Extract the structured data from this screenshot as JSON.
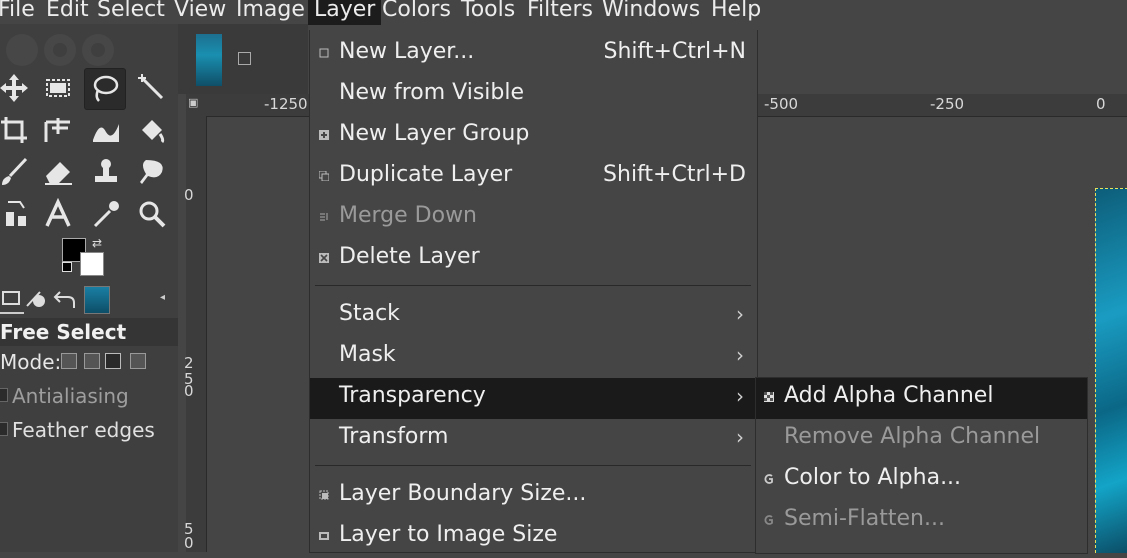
{
  "menubar": {
    "items": [
      {
        "label": "File"
      },
      {
        "label": "Edit"
      },
      {
        "label": "Select"
      },
      {
        "label": "View"
      },
      {
        "label": "Image"
      },
      {
        "label": "Layer"
      },
      {
        "label": "Colors"
      },
      {
        "label": "Tools"
      },
      {
        "label": "Filters"
      },
      {
        "label": "Windows"
      },
      {
        "label": "Help"
      }
    ],
    "active": "Layer"
  },
  "toolbox": {
    "tools": [
      {
        "icon": "move-icon"
      },
      {
        "icon": "rect-select-icon"
      },
      {
        "icon": "free-select-icon",
        "selected": true
      },
      {
        "icon": "fuzzy-select-icon"
      },
      {
        "icon": "crop-icon"
      },
      {
        "icon": "unified-transform-icon"
      },
      {
        "icon": "warp-transform-icon"
      },
      {
        "icon": "bucket-fill-icon"
      },
      {
        "icon": "paintbrush-icon"
      },
      {
        "icon": "eraser-icon"
      },
      {
        "icon": "clone-icon"
      },
      {
        "icon": "smudge-icon"
      },
      {
        "icon": "paths-icon"
      },
      {
        "icon": "text-icon"
      },
      {
        "icon": "color-picker-icon"
      },
      {
        "icon": "zoom-icon"
      }
    ],
    "fg_color": "#000000",
    "bg_color": "#ffffff",
    "options": {
      "title": "Free Select",
      "mode_label": "Mode:",
      "antialiasing": "Antialiasing",
      "feather_edges": "Feather edges"
    }
  },
  "rulers": {
    "h_labels": [
      "-1250",
      "-500",
      "-250",
      "0"
    ],
    "v_labels": [
      "0",
      "2",
      "5",
      "0",
      "5",
      "0"
    ]
  },
  "layer_menu": {
    "items": [
      {
        "label": "New Layer...",
        "shortcut": "Shift+Ctrl+N",
        "icon": "new-layer-icon"
      },
      {
        "label": "New from Visible"
      },
      {
        "label": "New Layer Group",
        "icon": "layer-group-icon"
      },
      {
        "label": "Duplicate Layer",
        "shortcut": "Shift+Ctrl+D",
        "icon": "duplicate-icon"
      },
      {
        "label": "Merge Down",
        "icon": "merge-icon",
        "disabled": true
      },
      {
        "label": "Delete Layer",
        "icon": "delete-icon"
      },
      {
        "label": "Stack",
        "submenu": true
      },
      {
        "label": "Mask",
        "submenu": true
      },
      {
        "label": "Transparency",
        "submenu": true,
        "highlighted": true
      },
      {
        "label": "Transform",
        "submenu": true
      },
      {
        "label": "Layer Boundary Size...",
        "icon": "boundary-icon"
      },
      {
        "label": "Layer to Image Size",
        "icon": "layer-to-image-icon"
      }
    ],
    "arrow": "›"
  },
  "transparency_submenu": {
    "items": [
      {
        "label": "Add Alpha Channel",
        "icon": "alpha-checker-icon",
        "highlighted": true
      },
      {
        "label": "Remove Alpha Channel",
        "disabled": true
      },
      {
        "label": "Color to Alpha...",
        "icon": "color-to-alpha-icon"
      },
      {
        "label": "Semi-Flatten...",
        "icon": "semi-flatten-icon",
        "disabled": true
      }
    ]
  }
}
